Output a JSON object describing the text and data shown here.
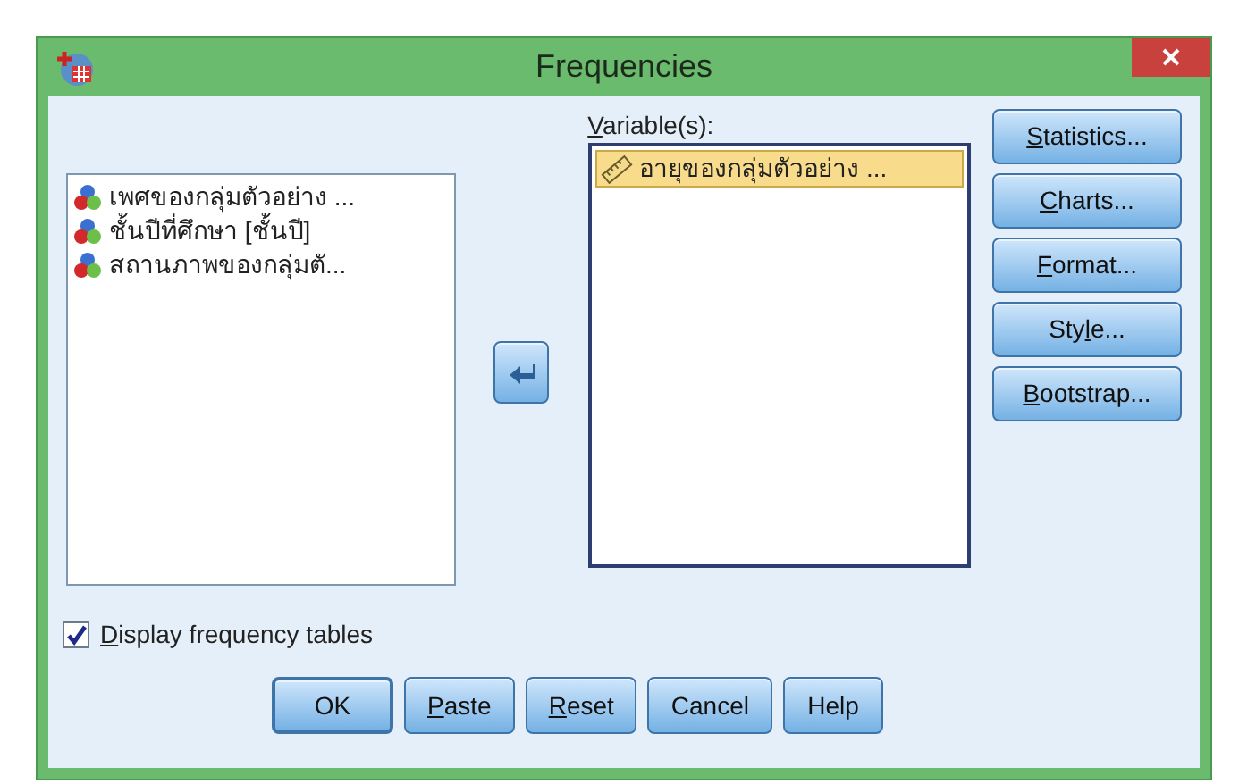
{
  "window": {
    "title": "Frequencies"
  },
  "source_list": {
    "items": [
      {
        "label": "เพศของกลุ่มตัวอย่าง ...",
        "kind": "nominal"
      },
      {
        "label": "ชั้นปีที่ศึกษา [ชั้นปี]",
        "kind": "nominal"
      },
      {
        "label": "สถานภาพของกลุ่มตั...",
        "kind": "nominal"
      }
    ]
  },
  "variables": {
    "label": {
      "key": "V",
      "post": "ariable(s):"
    },
    "items": [
      {
        "label": "อายุของกลุ่มตัวอย่าง ...",
        "kind": "scale",
        "selected": true
      }
    ]
  },
  "side_buttons": [
    {
      "key": "S",
      "post": "tatistics..."
    },
    {
      "key": "C",
      "post": "harts..."
    },
    {
      "key": "F",
      "post": "ormat..."
    },
    {
      "pre": "Sty",
      "key": "l",
      "post": "e..."
    },
    {
      "key": "B",
      "post": "ootstrap..."
    }
  ],
  "display_frequency_tables": {
    "checked": true,
    "label": {
      "key": "D",
      "post": "isplay frequency tables"
    }
  },
  "bottom_buttons": [
    {
      "post": "OK",
      "default": true
    },
    {
      "key": "P",
      "post": "aste",
      "default": false
    },
    {
      "key": "R",
      "post": "eset",
      "default": false
    },
    {
      "post": "Cancel",
      "default": false
    },
    {
      "post": "Help",
      "default": false
    }
  ]
}
